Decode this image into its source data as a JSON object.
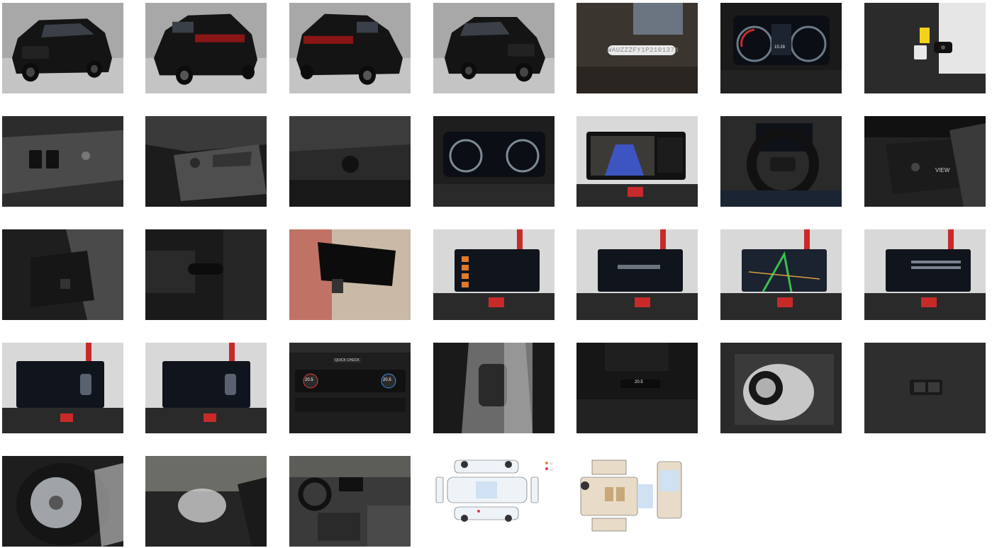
{
  "gallery": {
    "vin_plate": "WAUZZZFY1P2101378",
    "cluster_time": "15:28",
    "steering_view_label": "VIEW",
    "center_console_badge": "QUICK CHECK",
    "climate_temp_left": "20.5",
    "climate_temp_right": "20.5",
    "rear_climate_temp": "20.5",
    "damage_legend": [
      {
        "label": "S1",
        "color": "#e8852f"
      },
      {
        "label": "S2",
        "color": "#e8344a"
      }
    ],
    "colors": {
      "studio_bg": "#9b9b9b",
      "car_body": "#151515",
      "screen_bg": "#10141c",
      "accent_red": "#c82a2a"
    }
  }
}
